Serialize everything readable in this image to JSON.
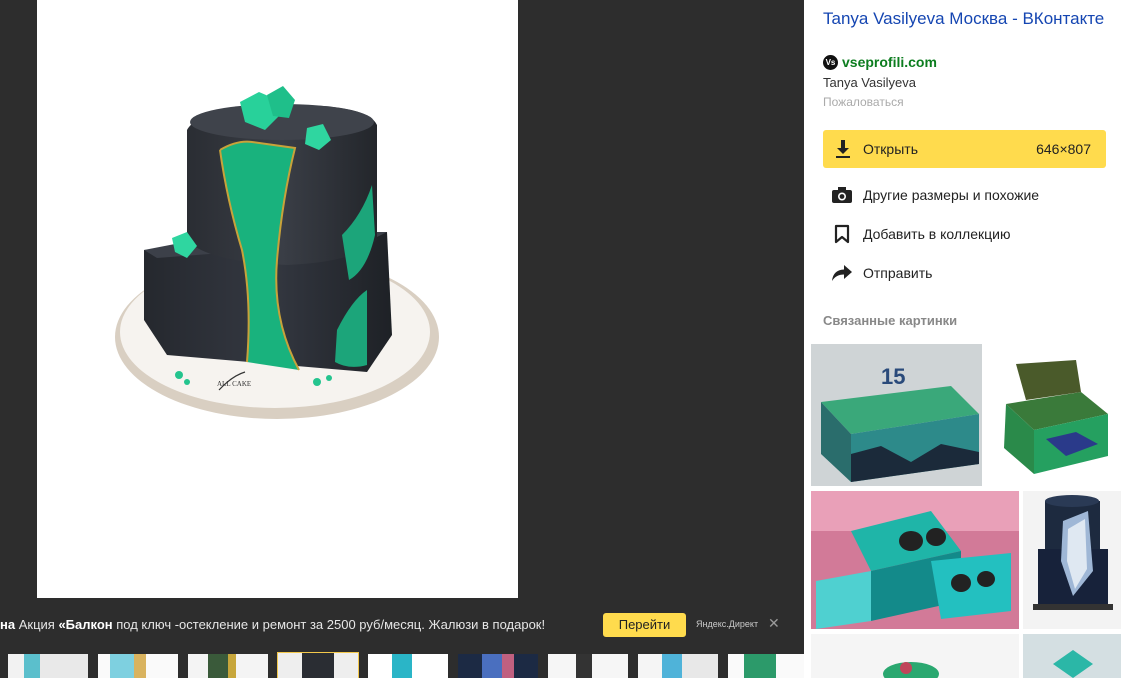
{
  "viewer": {
    "ad": {
      "cut_prefix": "на",
      "text_before": "Акция ",
      "bold": "«Балкон",
      "text_after": " под ключ -остекление и ремонт за 2500 руб/месяц. Жалюзи в подарок!",
      "button_label": "Перейти",
      "source": "Яндекс.Директ",
      "close_symbol": "✕"
    },
    "cake_label": "ALL CAKE"
  },
  "panel": {
    "title": "Tanya Vasilyeva Москва - ВКонтакте",
    "favicon_text": "Vs",
    "site": "vseprofili.com",
    "author": "Tanya Vasilyeva",
    "report": "Пожаловаться",
    "open_label": "Открыть",
    "open_size": "646×807",
    "actions": {
      "other_sizes": "Другие размеры и похожие",
      "add_collection": "Добавить в коллекцию",
      "share": "Отправить"
    },
    "related_title": "Связанные картинки",
    "related_number": "15"
  },
  "colors": {
    "accent": "#ffdb4d",
    "link": "#1546b2",
    "site": "#0c7d1f"
  }
}
